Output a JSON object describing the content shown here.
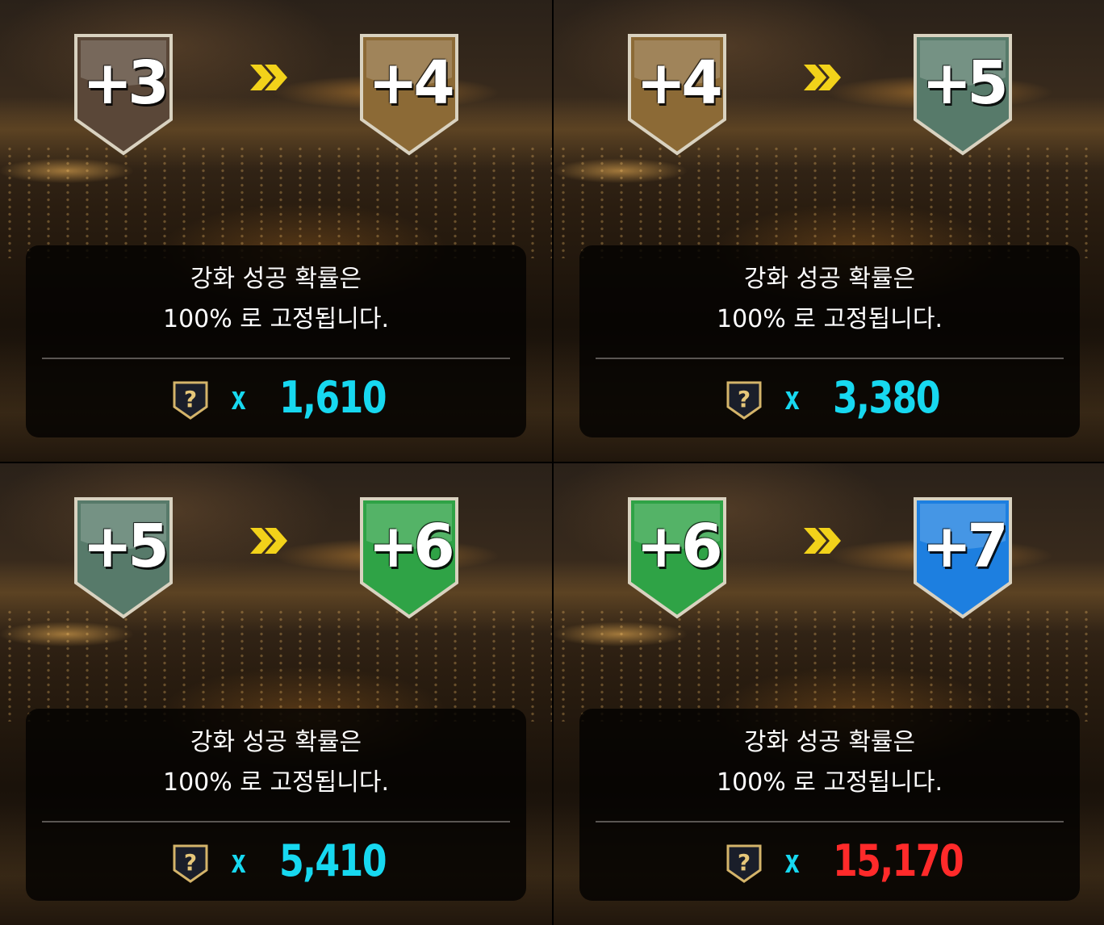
{
  "panels": [
    {
      "from_label": "+3",
      "to_label": "+4",
      "from_color": "#5a4738",
      "to_color": "#8c6a36",
      "message_line1": "강화 성공 확률은",
      "message_line2": "100% 로 고정됩니다.",
      "times_symbol": "x",
      "amount": "1,610",
      "amount_color": "#17d8f0",
      "item_icon": "question-shield-icon"
    },
    {
      "from_label": "+4",
      "to_label": "+5",
      "from_color": "#8c6a36",
      "to_color": "#577a6a",
      "message_line1": "강화 성공 확률은",
      "message_line2": "100% 로 고정됩니다.",
      "times_symbol": "x",
      "amount": "3,380",
      "amount_color": "#17d8f0",
      "item_icon": "question-shield-icon"
    },
    {
      "from_label": "+5",
      "to_label": "+6",
      "from_color": "#577a6a",
      "to_color": "#2fa346",
      "message_line1": "강화 성공 확률은",
      "message_line2": "100% 로 고정됩니다.",
      "times_symbol": "x",
      "amount": "5,410",
      "amount_color": "#17d8f0",
      "item_icon": "question-shield-icon"
    },
    {
      "from_label": "+6",
      "to_label": "+7",
      "from_color": "#2fa346",
      "to_color": "#1d7fe0",
      "message_line1": "강화 성공 확률은",
      "message_line2": "100% 로 고정됩니다.",
      "times_symbol": "x",
      "amount": "15,170",
      "amount_color": "#ff2a2a",
      "item_icon": "question-shield-icon"
    }
  ],
  "arrow_icon": "double-chevron-right-icon",
  "arrow_color": "#f2d21a"
}
